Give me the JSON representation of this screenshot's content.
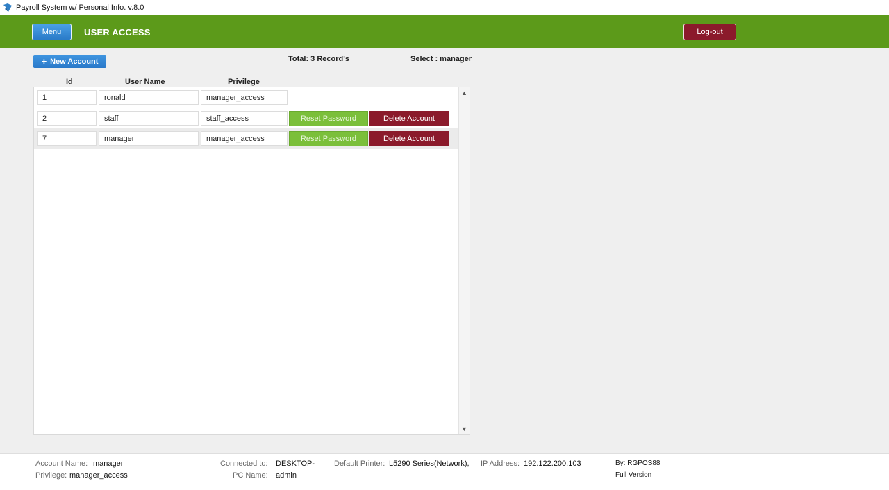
{
  "window": {
    "title": "Payroll System w/ Personal Info. v.8.0"
  },
  "header": {
    "menu_label": "Menu",
    "page_title": "USER ACCESS",
    "logout_label": "Log-out",
    "brand_color": "#5c9a1a"
  },
  "toolbar": {
    "new_account_label": "New Account",
    "total_text": "Total: 3 Record's",
    "select_text": "Select : manager"
  },
  "table": {
    "columns": [
      "Id",
      "User Name",
      "Privilege"
    ],
    "rows": [
      {
        "id": "1",
        "username": "ronald",
        "privilege": "manager_access"
      },
      {
        "id": "2",
        "username": "staff",
        "privilege": "staff_access",
        "reset_label": "Reset Password",
        "delete_label": "Delete Account"
      },
      {
        "id": "7",
        "username": "manager",
        "privilege": "manager_access",
        "reset_label": "Reset Password",
        "delete_label": "Delete Account"
      }
    ]
  },
  "status": {
    "account_name_label": "Account Name:",
    "account_name": "manager",
    "privilege_label": "Privilege:",
    "privilege": "manager_access",
    "connected_label": "Connected to:",
    "connected_value": "DESKTOP-",
    "pc_name_label": "PC Name:",
    "pc_name_value": "admin",
    "printer_label": "Default Printer:",
    "printer_value": "L5290 Series(Network),",
    "ip_label": "IP Address:",
    "ip_value": "192.122.200.103",
    "by_text": "By: RGPOS88",
    "version_text": "Full Version"
  }
}
